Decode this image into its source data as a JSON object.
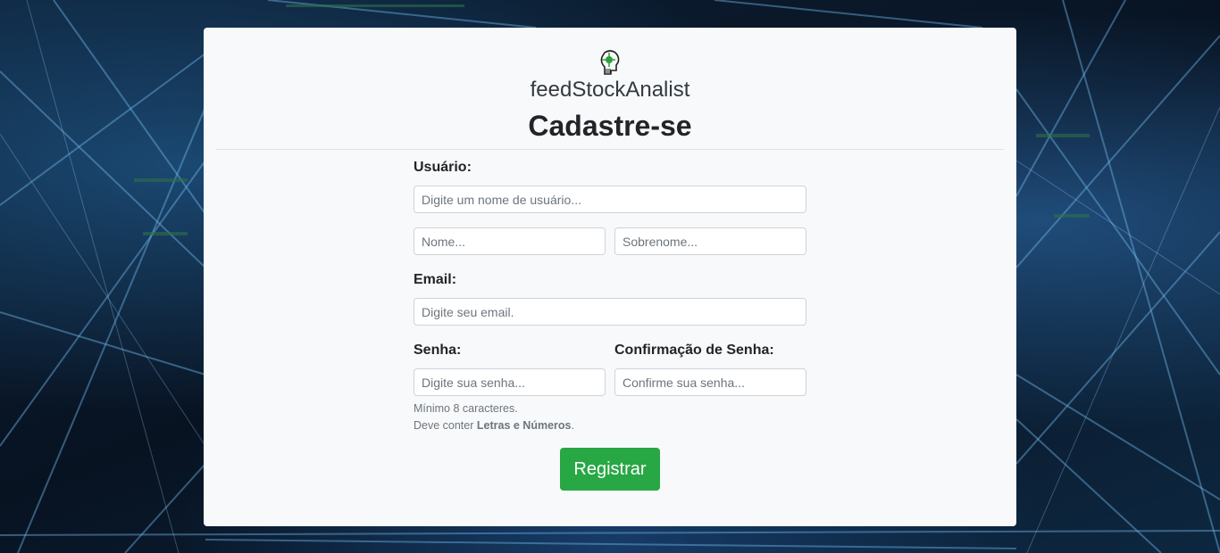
{
  "brand": {
    "name": "feedStockAnalist",
    "logo_icon": "robot-head-circuit-icon"
  },
  "page": {
    "title": "Cadastre-se"
  },
  "form": {
    "username_label": "Usuário:",
    "username_placeholder": "Digite um nome de usuário...",
    "first_name_placeholder": "Nome...",
    "last_name_placeholder": "Sobrenome...",
    "email_label": "Email:",
    "email_placeholder": "Digite seu email.",
    "password_label": "Senha:",
    "password_placeholder": "Digite sua senha...",
    "confirm_label": "Confirmação de Senha:",
    "confirm_placeholder": "Confirme sua senha...",
    "hint_line1": "Mínimo 8 caracteres.",
    "hint_line2_prefix": "Deve conter ",
    "hint_line2_bold": "Letras e Números",
    "hint_line2_suffix": ".",
    "submit_label": "Registrar"
  },
  "colors": {
    "accent": "#28a745",
    "card_bg": "#f8f9fa",
    "text": "#212529"
  }
}
